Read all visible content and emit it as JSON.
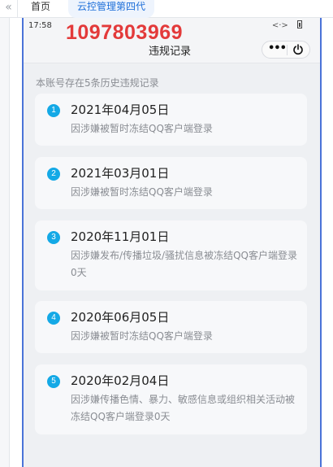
{
  "tabs": {
    "back_icon": "chevrons-left-icon",
    "home": "首页",
    "active": "云控管理第四代"
  },
  "status": {
    "time": "17:58",
    "signal_glyph": "<·>"
  },
  "overlay": {
    "account_number": "1097803969",
    "color": "#e33a3a"
  },
  "header": {
    "title": "违规记录",
    "more_label": "•••"
  },
  "summary": "本账号存在5条历史违规记录",
  "records": [
    {
      "index": "1",
      "date": "2021年04月05日",
      "desc": "因涉嫌被暂时冻结QQ客户端登录"
    },
    {
      "index": "2",
      "date": "2021年03月01日",
      "desc": "因涉嫌被暂时冻结QQ客户端登录"
    },
    {
      "index": "3",
      "date": "2020年11月01日",
      "desc": "因涉嫌发布/传播垃圾/骚扰信息被冻结QQ客户端登录0天"
    },
    {
      "index": "4",
      "date": "2020年06月05日",
      "desc": "因涉嫌被暂时冻结QQ客户端登录"
    },
    {
      "index": "5",
      "date": "2020年02月04日",
      "desc": "因涉嫌传播色情、暴力、敏感信息或组织相关活动被冻结QQ客户端登录0天"
    }
  ],
  "colors": {
    "accent": "#1e6fd9",
    "badge": "#14a9e6",
    "frame": "#4a73d8"
  }
}
